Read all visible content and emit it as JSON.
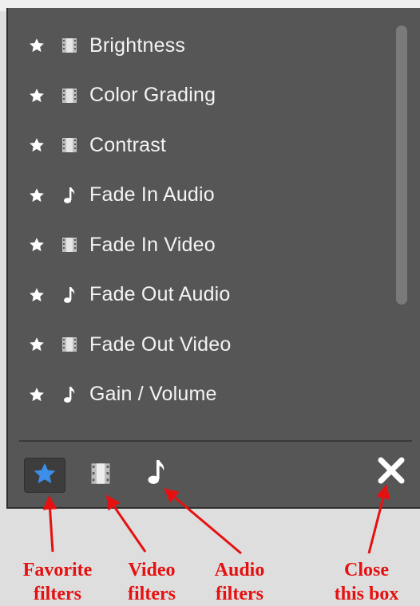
{
  "filters": [
    {
      "label": "Brightness",
      "type_icon": "film-icon"
    },
    {
      "label": "Color Grading",
      "type_icon": "film-icon"
    },
    {
      "label": "Contrast",
      "type_icon": "film-icon"
    },
    {
      "label": "Fade In Audio",
      "type_icon": "music-note-icon"
    },
    {
      "label": "Fade In Video",
      "type_icon": "film-icon"
    },
    {
      "label": "Fade Out Audio",
      "type_icon": "music-note-icon"
    },
    {
      "label": "Fade Out Video",
      "type_icon": "film-icon"
    },
    {
      "label": "Gain / Volume",
      "type_icon": "music-note-icon"
    }
  ],
  "toolbar": {
    "favorites_icon": "star-icon",
    "video_icon": "film-icon",
    "audio_icon": "music-note-icon",
    "close_icon": "close-icon",
    "active_color": "#3d8ee8"
  },
  "annotations": {
    "favorites": [
      "Favorite",
      "filters"
    ],
    "video": [
      "Video",
      "filters"
    ],
    "audio": [
      "Audio",
      "filters"
    ],
    "close": [
      "Close",
      "this box"
    ],
    "color": "#e51111"
  }
}
